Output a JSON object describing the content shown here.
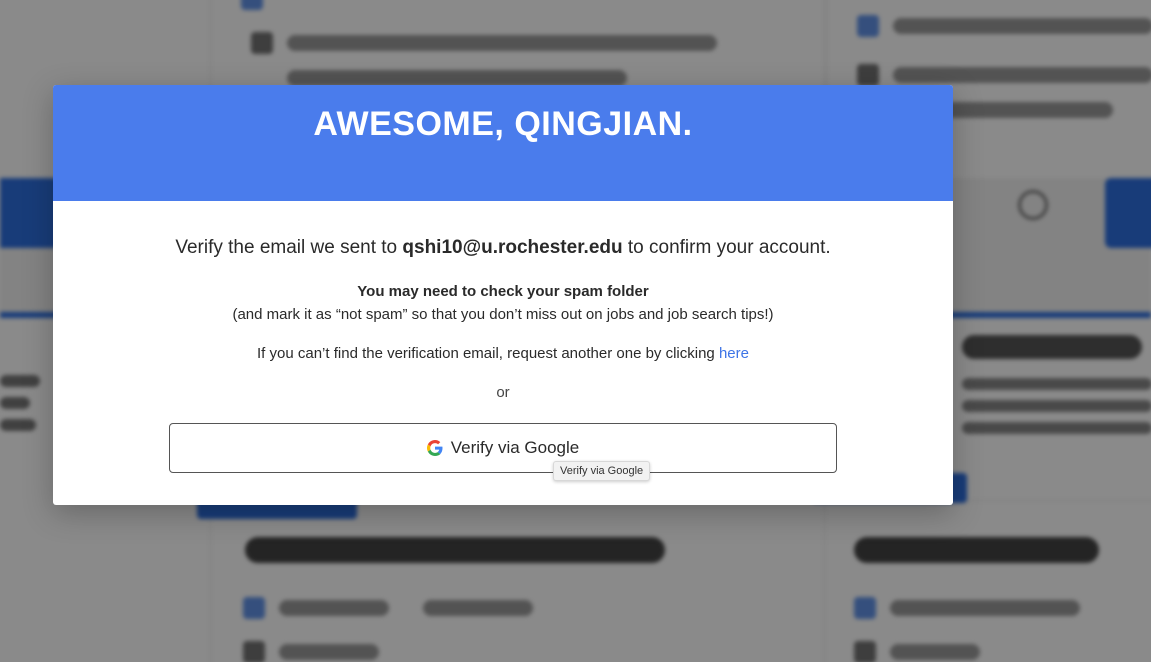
{
  "modal": {
    "title": "AWESOME, QINGJIAN.",
    "verify_prefix": "Verify the email we sent to ",
    "email": "qshi10@u.rochester.edu",
    "verify_suffix": " to confirm your account.",
    "spam_heading": "You may need to check your spam folder",
    "spam_note": "(and mark it as “not spam” so that you don’t miss out on jobs and job search tips!)",
    "resend_text": "If you can’t find the verification email, request another one by clicking ",
    "resend_link": "here",
    "or_text": "or",
    "google_button_label": "Verify via Google",
    "tooltip": "Verify via Google"
  },
  "colors": {
    "header_blue": "#4a7cec",
    "link_blue": "#3d74e6",
    "overlay": "rgba(0,0,0,0.46)"
  },
  "icons": {
    "google": "google-g-icon"
  }
}
